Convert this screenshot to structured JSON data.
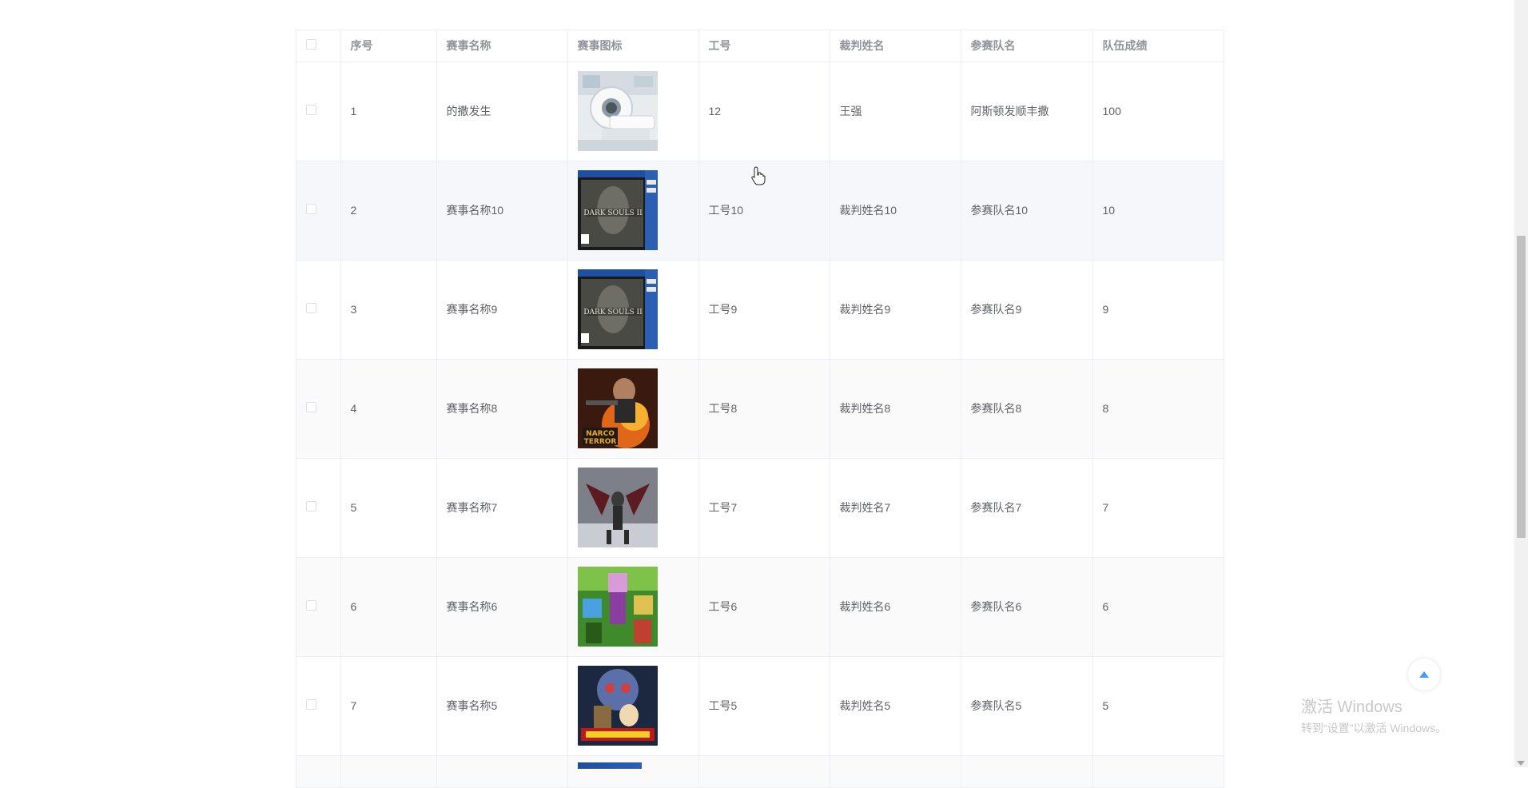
{
  "table": {
    "headers": [
      "序号",
      "赛事名称",
      "赛事图标",
      "工号",
      "裁判姓名",
      "参赛队名",
      "队伍成绩"
    ],
    "rows": [
      {
        "index": "1",
        "name": "的撒发生",
        "icon": "mri-scanner-image",
        "job_no": "12",
        "referee": "王强",
        "team": "阿斯顿发顺丰撒",
        "score": "100"
      },
      {
        "index": "2",
        "name": "赛事名称10",
        "icon": "dark-souls-cover-image",
        "job_no": "工号10",
        "referee": "裁判姓名10",
        "team": "参赛队名10",
        "score": "10"
      },
      {
        "index": "3",
        "name": "赛事名称9",
        "icon": "dark-souls-cover-image",
        "job_no": "工号9",
        "referee": "裁判姓名9",
        "team": "参赛队名9",
        "score": "9"
      },
      {
        "index": "4",
        "name": "赛事名称8",
        "icon": "narco-terror-cover-image",
        "job_no": "工号8",
        "referee": "裁判姓名8",
        "team": "参赛队名8",
        "score": "8"
      },
      {
        "index": "5",
        "name": "赛事名称7",
        "icon": "bladed-warrior-image",
        "job_no": "工号7",
        "referee": "裁判姓名7",
        "team": "参赛队名7",
        "score": "7"
      },
      {
        "index": "6",
        "name": "赛事名称6",
        "icon": "blocky-characters-image",
        "job_no": "工号6",
        "referee": "裁判姓名6",
        "team": "参赛队名6",
        "score": "6"
      },
      {
        "index": "7",
        "name": "赛事名称5",
        "icon": "one-punch-man-cover-image",
        "job_no": "工号5",
        "referee": "裁判姓名5",
        "team": "参赛队名5",
        "score": "5"
      }
    ]
  },
  "watermark": {
    "title": "激活 Windows",
    "subtitle": "转到“设置”以激活 Windows。"
  },
  "colors": {
    "accent": "#409eff",
    "border": "#ebeef5",
    "header_text": "#909399",
    "body_text": "#606266"
  }
}
